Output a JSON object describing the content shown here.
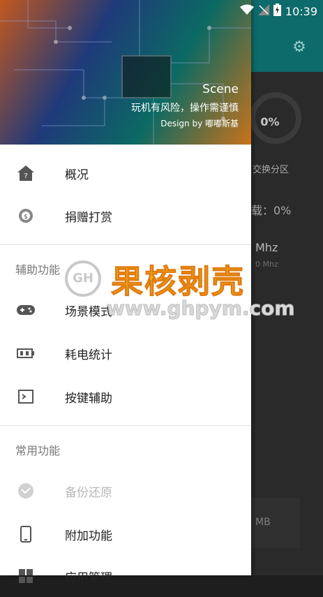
{
  "status": {
    "time": "10:39"
  },
  "background": {
    "ring_value": "0%",
    "ring_label": "交换分区",
    "load_text": "载：0%",
    "freq_value": "Mhz",
    "freq_sub": "0 Mhz",
    "mem_text": "MB"
  },
  "drawer": {
    "header": {
      "app_name": "Scene",
      "tagline": "玩机有风险，操作需谨慎",
      "credit": "Design by 嘟嘟斯基"
    },
    "top_items": [
      {
        "label": "概况",
        "icon": "home-icon"
      },
      {
        "label": "捐赠打赏",
        "icon": "donate-icon"
      }
    ],
    "sections": [
      {
        "title": "辅助功能",
        "items": [
          {
            "label": "场景模式",
            "icon": "gamepad-icon"
          },
          {
            "label": "耗电统计",
            "icon": "battery-icon"
          },
          {
            "label": "按键辅助",
            "icon": "terminal-icon"
          }
        ]
      },
      {
        "title": "常用功能",
        "items": [
          {
            "label": "备份还原",
            "icon": "backup-icon",
            "disabled": true
          },
          {
            "label": "附加功能",
            "icon": "phone-icon"
          },
          {
            "label": "应用管理",
            "icon": "apps-icon"
          }
        ]
      }
    ]
  },
  "watermark": {
    "title": "果核剥壳",
    "url": "www.ghpym.com",
    "logo": "GH"
  }
}
